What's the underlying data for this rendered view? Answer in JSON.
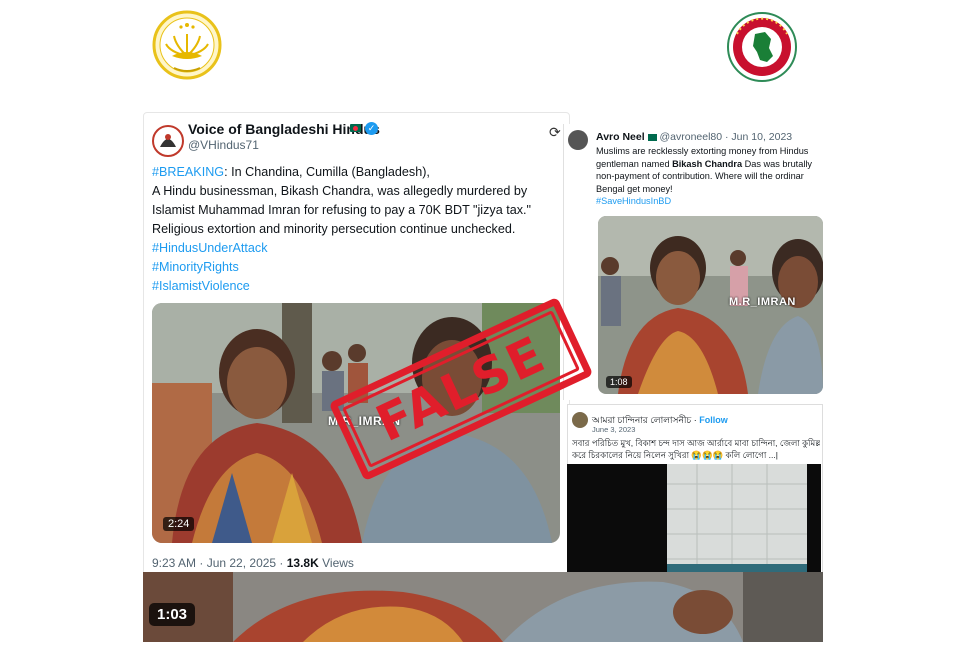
{
  "main_tweet": {
    "display_name": "Voice of Bangladeshi Hindus",
    "handle": "@VHindus71",
    "body_lines": [
      {
        "tag": "#BREAKING",
        "text": ": In Chandina, Cumilla (Bangladesh),"
      },
      {
        "tag": "",
        "text": "A Hindu businessman, Bikash Chandra, was allegedly murdered by"
      },
      {
        "tag": "",
        "text": "Islamist Muhammad Imran for refusing to pay a 70K BDT \"jizya tax.\""
      },
      {
        "tag": "",
        "text": "Religious extortion and minority persecution continue unchecked."
      }
    ],
    "hashtags": [
      "#HindusUnderAttack",
      "#MinorityRights",
      "#IslamistViolence"
    ],
    "video_duration": "2:24",
    "timestamp": "9:23 AM · Jun 22, 2025 · ",
    "views_count": "13.8K",
    "views_label": " Views",
    "watermark": "M.R_IMRAN"
  },
  "avro_tweet": {
    "display_name": "Avro Neel",
    "meta": " @avroneel80 · Jun 10, 2023",
    "lines": [
      "Muslims are recklessly extorting money from Hindus",
      "gentleman named ",
      "non-payment of contribution. Where will the ordinar",
      "Bengal get money!"
    ],
    "bold_name": "Bikash Chandra",
    "line2_tail": " Das was brutally",
    "hashtag": "#SaveHindusInBD",
    "video_duration": "1:08",
    "watermark": "M.R_IMRAN"
  },
  "bengali_tweet": {
    "display_name": "আমরা চান্দিনার লোলাসনীচ",
    "follow_label": "Follow",
    "date": "June 3, 2023",
    "lines": [
      "সবার পরিচিত মুখ, বিকাশ চন্দ দাস আজ আর্রাবে মাবা চান্দিনা, জেলা কুমিল্লা এক",
      "করে চিরকালের নিয়ে নিলেন সুখিরা 😭😭😭 কলি লোগো ...|"
    ]
  },
  "bottom_video": {
    "duration": "1:03"
  },
  "stamp": {
    "label": "FALSE",
    "color": "#e01e2b"
  },
  "colors": {
    "link_blue": "#1d9bf0",
    "flag_green": "#006a4e",
    "flag_red": "#f42a41"
  },
  "icons": {
    "left_logo": "bangladesh-shapla-emblem",
    "right_logo": "bangladesh-government-seal",
    "verified": "verified-badge-icon",
    "refresh": "refresh-icon"
  }
}
